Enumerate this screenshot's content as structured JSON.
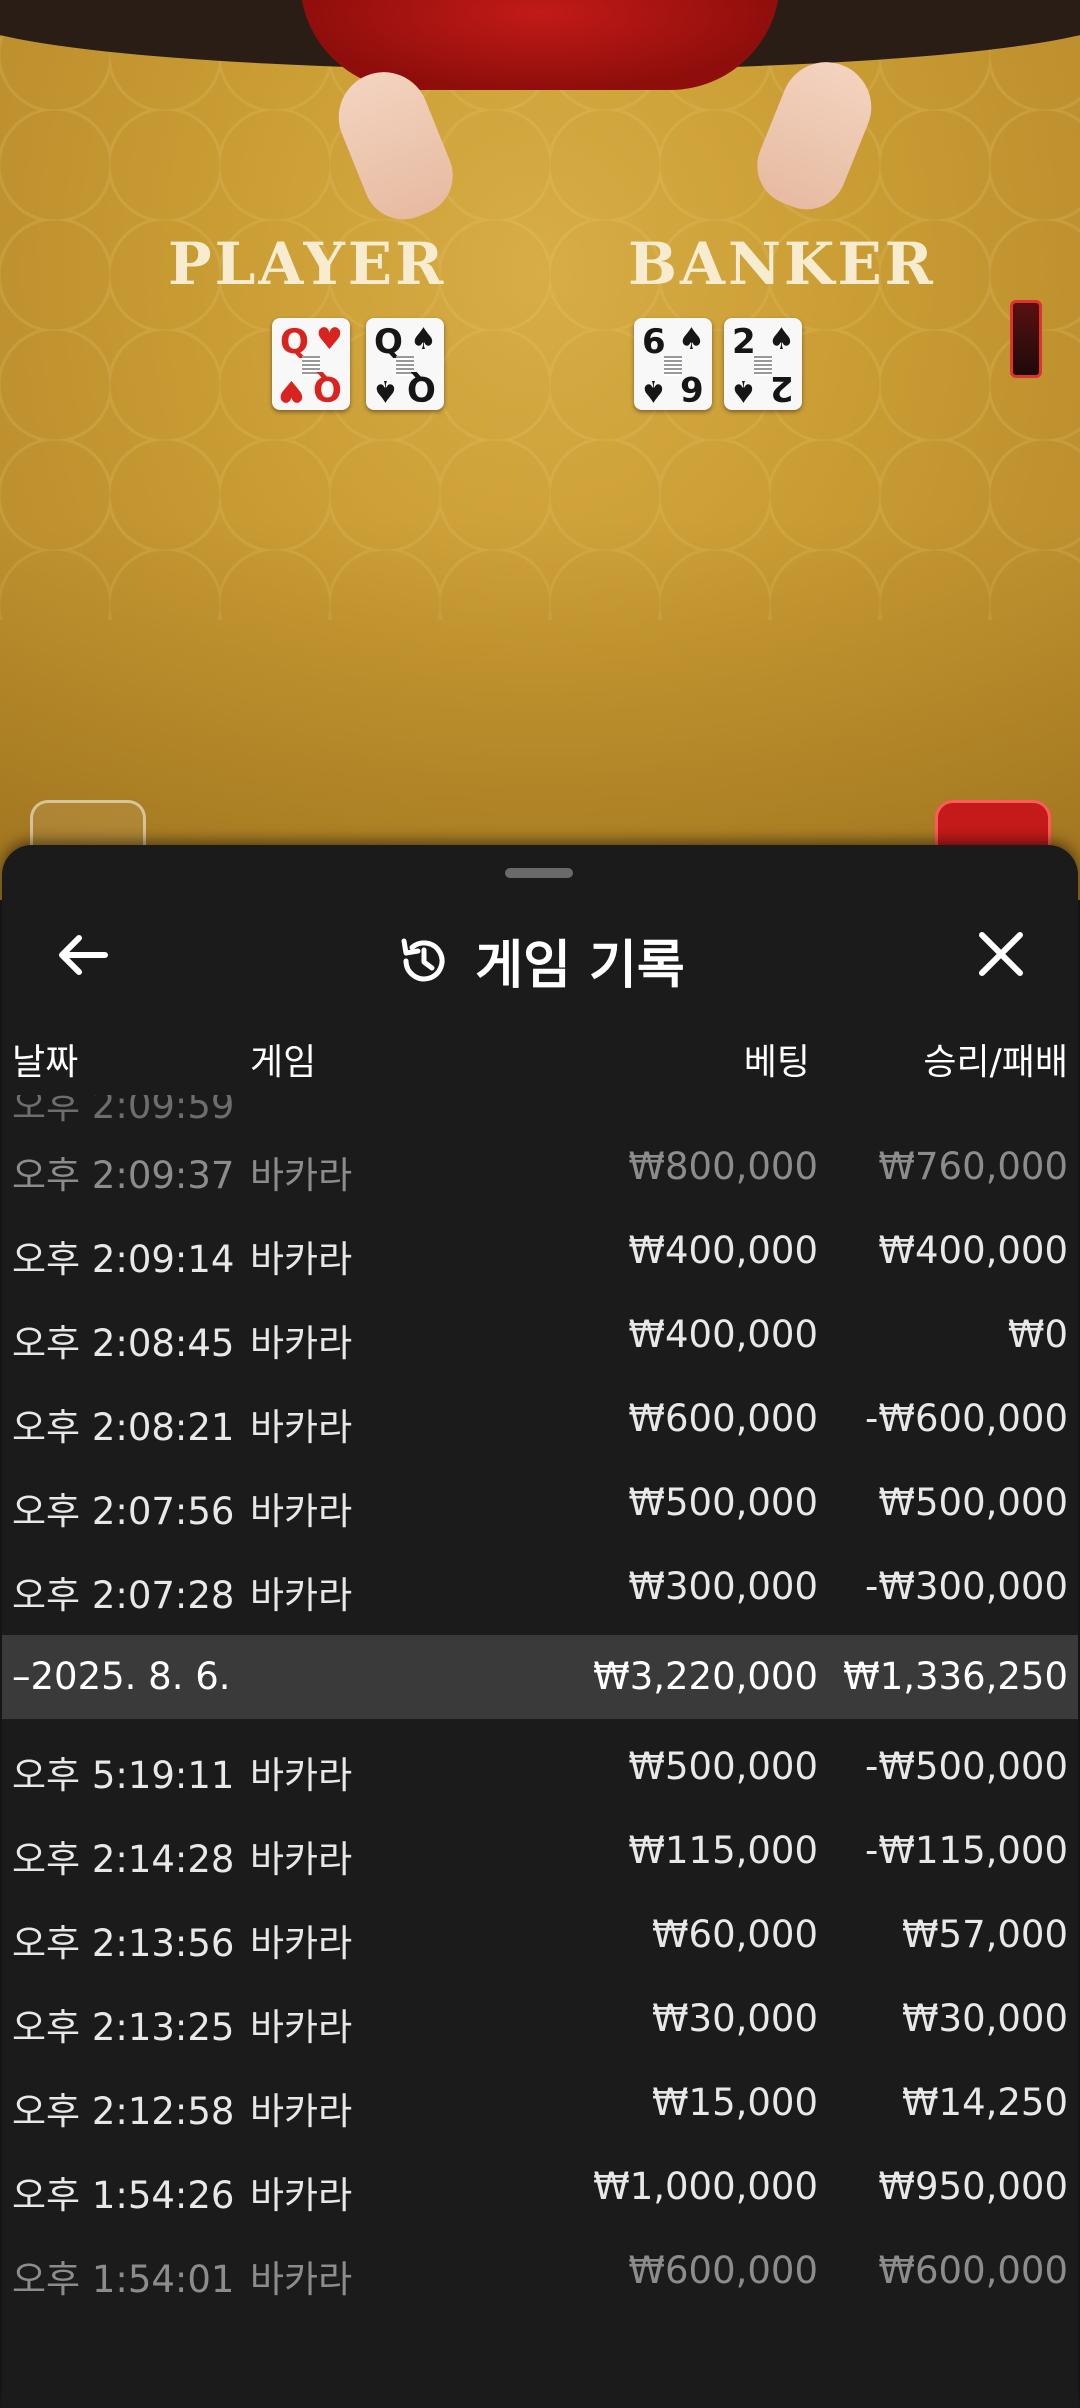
{
  "table": {
    "player_label": "PLAYER",
    "banker_label": "BANKER",
    "player_cards": [
      {
        "rank": "Q",
        "suit": "♥",
        "color": "#d9231e"
      },
      {
        "rank": "Q",
        "suit": "♠",
        "color": "#161616"
      }
    ],
    "banker_cards": [
      {
        "rank": "6",
        "suit": "♠",
        "color": "#161616"
      },
      {
        "rank": "2",
        "suit": "♠",
        "color": "#161616"
      }
    ]
  },
  "sheet": {
    "back_icon": "arrow-left-icon",
    "history_icon": "history-icon",
    "close_icon": "close-icon",
    "title": "게임 기록"
  },
  "columns": {
    "date": "날짜",
    "game": "게임",
    "bet": "베팅",
    "result": "승리/패배"
  },
  "rows_top": [
    {
      "time": "오후 2:09:37",
      "game": "바카라",
      "bet": "₩800,000",
      "result": "₩760,000",
      "faded": true
    },
    {
      "time": "오후 2:09:14",
      "game": "바카라",
      "bet": "₩400,000",
      "result": "₩400,000"
    },
    {
      "time": "오후 2:08:45",
      "game": "바카라",
      "bet": "₩400,000",
      "result": "₩0"
    },
    {
      "time": "오후 2:08:21",
      "game": "바카라",
      "bet": "₩600,000",
      "result": "-₩600,000"
    },
    {
      "time": "오후 2:07:56",
      "game": "바카라",
      "bet": "₩500,000",
      "result": "₩500,000"
    },
    {
      "time": "오후 2:07:28",
      "game": "바카라",
      "bet": "₩300,000",
      "result": "-₩300,000"
    }
  ],
  "day_summary": {
    "date": "–2025. 8. 6.",
    "bet_total": "₩3,220,000",
    "result_total": "₩1,336,250"
  },
  "rows_bottom": [
    {
      "time": "오후 5:19:11",
      "game": "바카라",
      "bet": "₩500,000",
      "result": "-₩500,000"
    },
    {
      "time": "오후 2:14:28",
      "game": "바카라",
      "bet": "₩115,000",
      "result": "-₩115,000"
    },
    {
      "time": "오후 2:13:56",
      "game": "바카라",
      "bet": "₩60,000",
      "result": "₩57,000"
    },
    {
      "time": "오후 2:13:25",
      "game": "바카라",
      "bet": "₩30,000",
      "result": "₩30,000"
    },
    {
      "time": "오후 2:12:58",
      "game": "바카라",
      "bet": "₩15,000",
      "result": "₩14,250"
    },
    {
      "time": "오후 1:54:26",
      "game": "바카라",
      "bet": "₩1,000,000",
      "result": "₩950,000"
    },
    {
      "time": "오후 1:54:01",
      "game": "바카라",
      "bet": "₩600,000",
      "result": "₩600,000",
      "faded": true
    }
  ]
}
